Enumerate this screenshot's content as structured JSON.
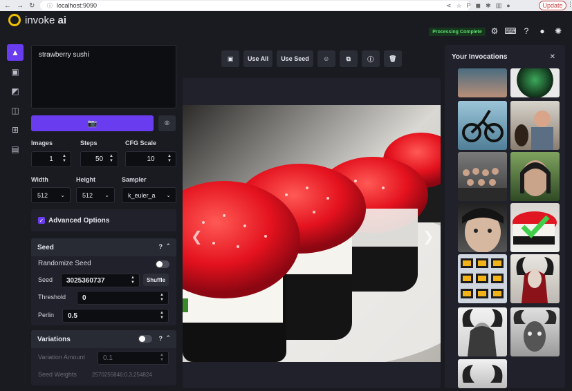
{
  "browser": {
    "url": "localhost:9090",
    "update_label": "Update"
  },
  "header": {
    "brand_prefix": "invoke",
    "brand_suffix": "ai",
    "status": "Processing Complete"
  },
  "prompt": {
    "value": "strawberry sushi"
  },
  "params": {
    "images_label": "Images",
    "images_value": "1",
    "steps_label": "Steps",
    "steps_value": "50",
    "cfg_label": "CFG Scale",
    "cfg_value": "10",
    "width_label": "Width",
    "width_value": "512",
    "height_label": "Height",
    "height_value": "512",
    "sampler_label": "Sampler",
    "sampler_value": "k_euler_a"
  },
  "advanced": {
    "label": "Advanced Options"
  },
  "seed_section": {
    "title": "Seed",
    "randomize_label": "Randomize Seed",
    "seed_label": "Seed",
    "seed_value": "3025360737",
    "shuffle_label": "Shuffle",
    "threshold_label": "Threshold",
    "threshold_value": "0",
    "perlin_label": "Perlin",
    "perlin_value": "0.5"
  },
  "variations_section": {
    "title": "Variations",
    "amount_label": "Variation Amount",
    "amount_value": "0.1",
    "weights_label": "Seed Weights",
    "weights_value": "2570255846:0.3,254824"
  },
  "toolbar": {
    "use_all": "Use All",
    "use_seed": "Use Seed"
  },
  "gallery": {
    "title": "Your Invocations"
  },
  "icons": {
    "logo": "logo-icon",
    "settings": "gear-icon",
    "keyboard": "keyboard-icon",
    "help": "help-icon",
    "github": "github-icon",
    "discord": "discord-icon"
  },
  "colors": {
    "accent": "#6a3cf0",
    "status_text": "#5ddc6c",
    "logo": "#f0c000"
  }
}
